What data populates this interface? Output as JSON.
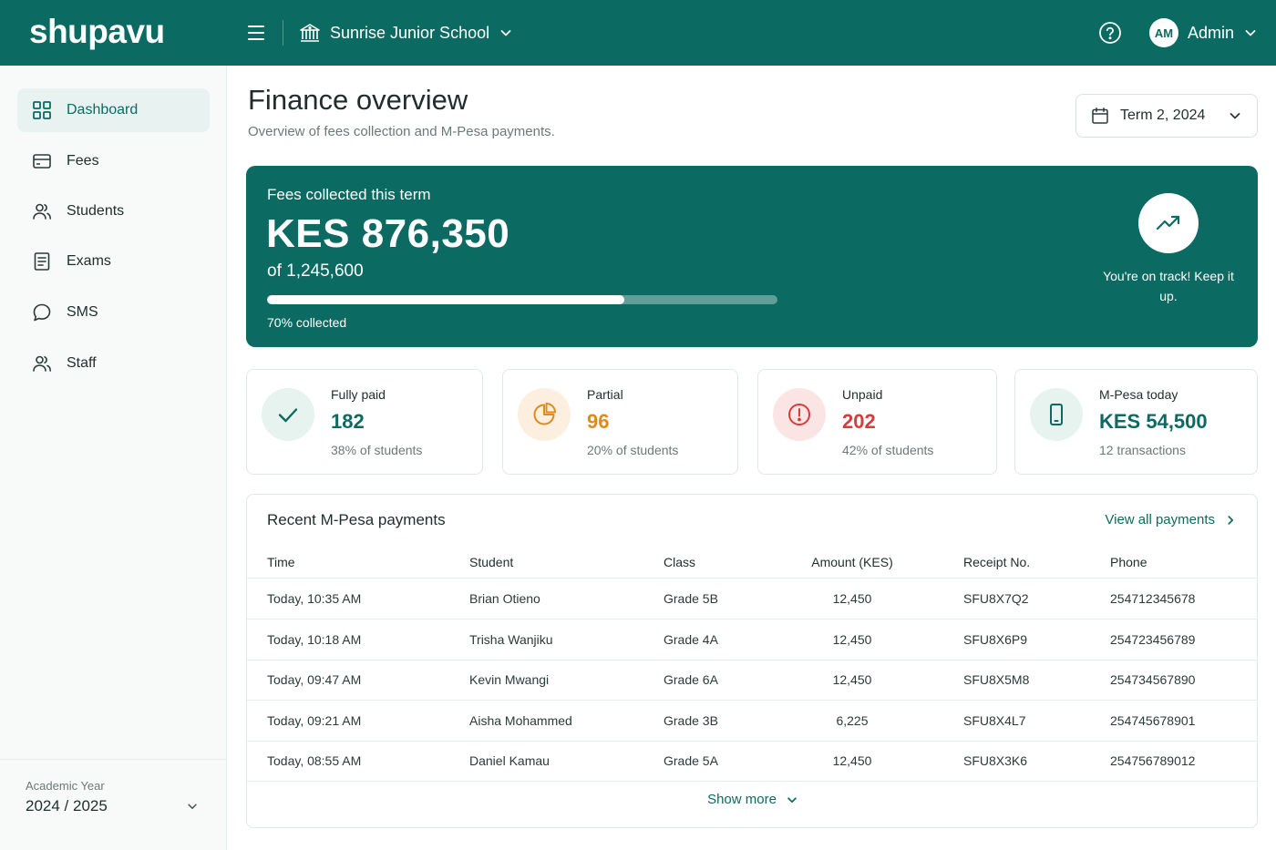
{
  "app": {
    "logo": "shupavu"
  },
  "topbar": {
    "school": "Sunrise Junior School",
    "avatar_initials": "AM",
    "user": "Admin"
  },
  "sidebar": {
    "items": [
      {
        "label": "Dashboard",
        "icon": "dashboard-icon",
        "active": true
      },
      {
        "label": "Fees",
        "icon": "card-icon"
      },
      {
        "label": "Students",
        "icon": "users-icon"
      },
      {
        "label": "Exams",
        "icon": "document-icon"
      },
      {
        "label": "SMS",
        "icon": "chat-icon"
      },
      {
        "label": "Staff",
        "icon": "users-icon"
      }
    ],
    "academic_year_label": "Academic Year",
    "academic_year": "2024 / 2025"
  },
  "header": {
    "title": "Finance overview",
    "subtitle": "Overview of fees collection and M-Pesa payments.",
    "term": "Term 2, 2024"
  },
  "hero": {
    "label": "Fees collected this term",
    "amount": "KES 876,350",
    "of_total": "of 1,245,600",
    "progress_percent": 70,
    "progress_label": "70% collected",
    "message": "You're on track! Keep it up."
  },
  "stats": [
    {
      "title": "Fully paid",
      "value": "182",
      "sub": "38% of students",
      "color": "#0b6b62",
      "icon": "check-icon"
    },
    {
      "title": "Partial",
      "value": "96",
      "sub": "20% of students",
      "color": "#e08a1e",
      "icon": "pie-chart-icon"
    },
    {
      "title": "Unpaid",
      "value": "202",
      "sub": "42% of students",
      "color": "#d93a3a",
      "icon": "alert-icon"
    },
    {
      "title": "M-Pesa today",
      "value": "KES 54,500",
      "sub": "12 transactions",
      "color": "#0b6b62",
      "icon": "phone-icon"
    }
  ],
  "payments": {
    "title": "Recent M-Pesa payments",
    "view_all": "View all payments",
    "columns": [
      "Time",
      "Student",
      "Class",
      "Amount (KES)",
      "Receipt No.",
      "Phone"
    ],
    "rows": [
      [
        "Today, 10:35 AM",
        "Brian Otieno",
        "Grade 5B",
        "12,450",
        "SFU8X7Q2",
        "254712345678"
      ],
      [
        "Today, 10:18 AM",
        "Trisha Wanjiku",
        "Grade 4A",
        "12,450",
        "SFU8X6P9",
        "254723456789"
      ],
      [
        "Today, 09:47 AM",
        "Kevin Mwangi",
        "Grade 6A",
        "12,450",
        "SFU8X5M8",
        "254734567890"
      ],
      [
        "Today, 09:21 AM",
        "Aisha Mohammed",
        "Grade 3B",
        "6,225",
        "SFU8X4L7",
        "254745678901"
      ],
      [
        "Today, 08:55 AM",
        "Daniel Kamau",
        "Grade 5A",
        "12,450",
        "SFU8X3K6",
        "254756789012"
      ]
    ],
    "show_more": "Show more"
  }
}
